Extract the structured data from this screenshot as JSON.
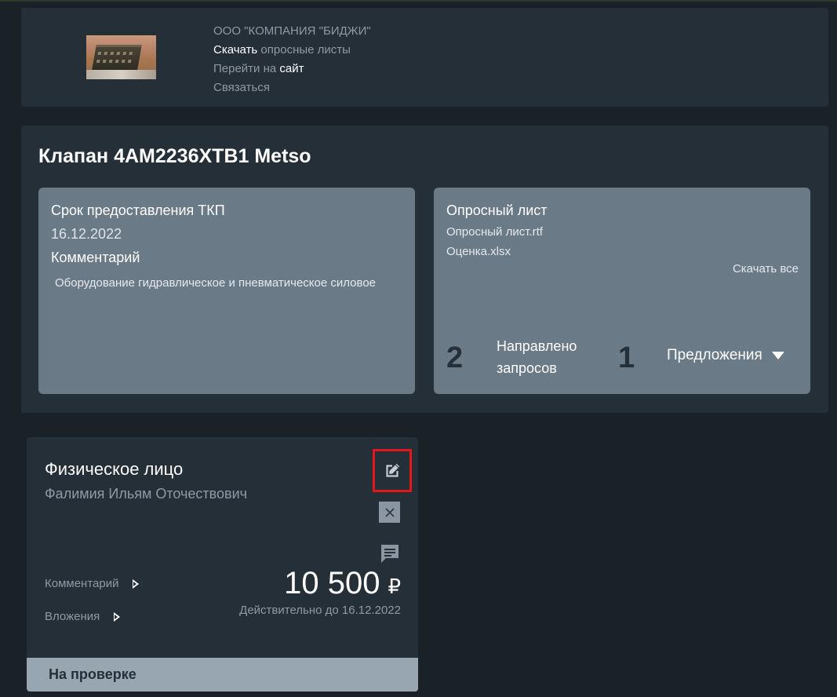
{
  "company": {
    "name": "ООО \"КОМПАНИЯ \"БИДЖИ\"",
    "download_prefix": "Скачать",
    "download_rest": " опросные листы",
    "goto_prefix": "Перейти на ",
    "goto_site": "сайт",
    "contact": "Связаться"
  },
  "request": {
    "title": "Клапан 4AM2236XTB1 Metso",
    "deadline_label": "Срок предоставления ТКП",
    "deadline_value": "16.12.2022",
    "comment_label": "Комментарий",
    "comment_text": "Оборудование гидравлическое и пневматическое силовое",
    "questionnaire_label": "Опросный лист",
    "files": [
      "Опросный лист.rtf",
      "Оценка.xlsx"
    ],
    "download_all": "Скачать все",
    "sent_count": "2",
    "sent_label_1": "Направлено",
    "sent_label_2": "запросов",
    "offers_count": "1",
    "offers_label": "Предложения"
  },
  "offer": {
    "type": "Физическое лицо",
    "person": "Фалимия Ильям Оточествович",
    "comment_toggle": "Комментарий",
    "attachments_toggle": "Вложения",
    "price": "10 500",
    "currency": "₽",
    "valid_until": "Действительно до 16.12.2022",
    "status": "На проверке",
    "icons": {
      "edit": "edit-icon",
      "close": "close-icon",
      "chat": "chat-icon"
    },
    "highlight_color": "#e3161c"
  }
}
